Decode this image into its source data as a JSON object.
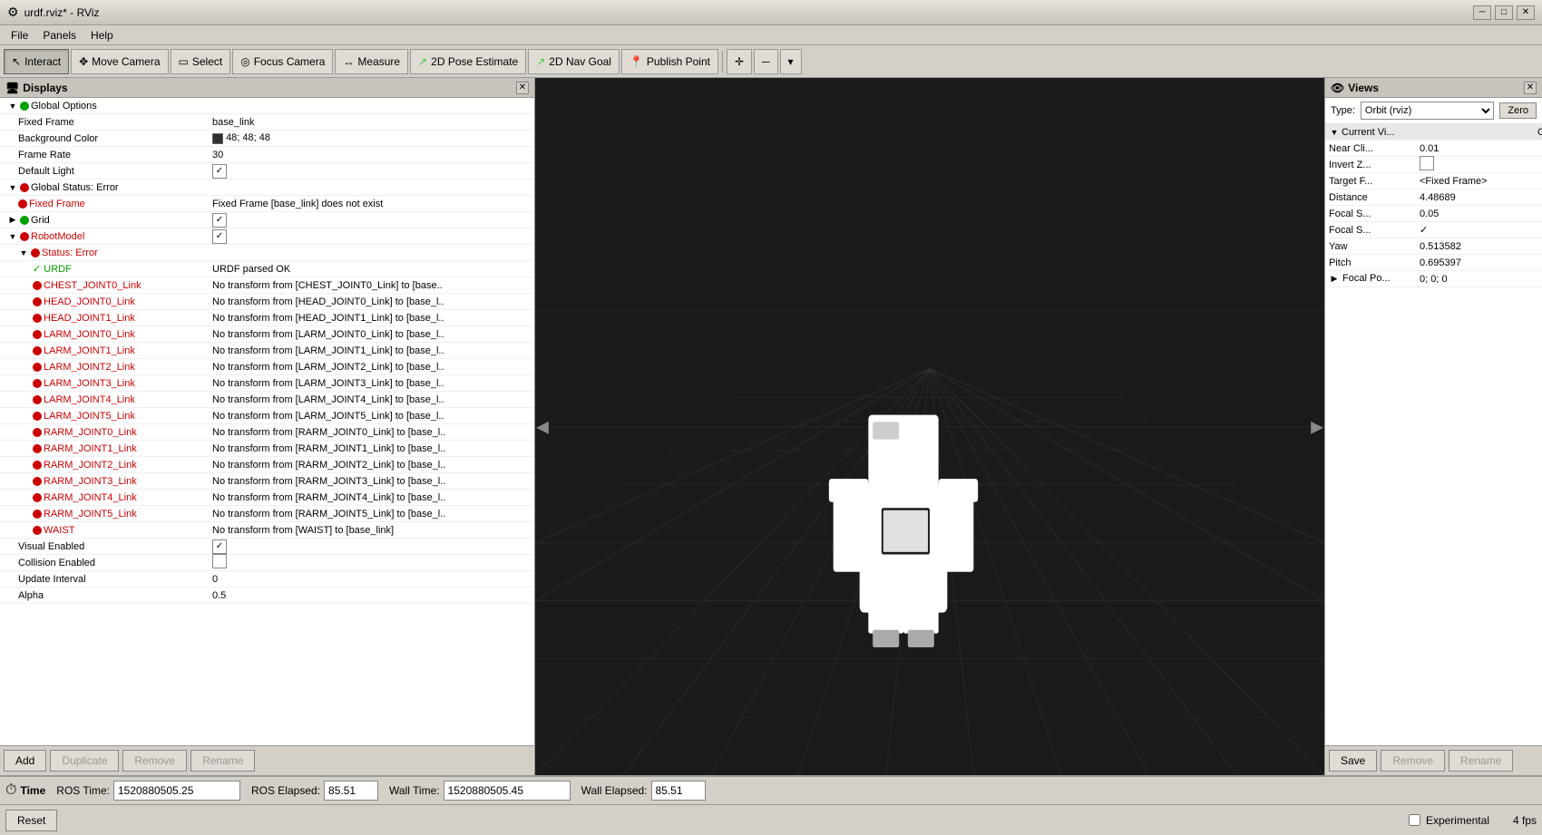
{
  "window": {
    "title": "urdf.rviz* - RViz",
    "icon": "rviz-icon"
  },
  "menu": {
    "items": [
      "File",
      "Panels",
      "Help"
    ]
  },
  "toolbar": {
    "buttons": [
      {
        "id": "interact",
        "label": "Interact",
        "icon": "cursor-icon",
        "active": true
      },
      {
        "id": "move-camera",
        "label": "Move Camera",
        "icon": "move-icon",
        "active": false
      },
      {
        "id": "select",
        "label": "Select",
        "icon": "select-icon",
        "active": false
      },
      {
        "id": "focus-camera",
        "label": "Focus Camera",
        "icon": "focus-icon",
        "active": false
      },
      {
        "id": "measure",
        "label": "Measure",
        "icon": "measure-icon",
        "active": false
      },
      {
        "id": "pose-estimate",
        "label": "2D Pose Estimate",
        "icon": "pose-icon",
        "active": false
      },
      {
        "id": "nav-goal",
        "label": "2D Nav Goal",
        "icon": "nav-icon",
        "active": false
      },
      {
        "id": "publish-point",
        "label": "Publish Point",
        "icon": "publish-icon",
        "active": false
      }
    ]
  },
  "displays": {
    "panel_title": "Displays",
    "items": [
      {
        "id": "global-options",
        "level": 1,
        "expanded": true,
        "label": "Global Options",
        "status": "green",
        "value": "",
        "has_expand": true
      },
      {
        "id": "fixed-frame",
        "level": 2,
        "label": "Fixed Frame",
        "value": "base_link",
        "status": null
      },
      {
        "id": "background-color",
        "level": 2,
        "label": "Background Color",
        "value": "48; 48; 48",
        "status": null,
        "has_color": true
      },
      {
        "id": "frame-rate",
        "level": 2,
        "label": "Frame Rate",
        "value": "30",
        "status": null
      },
      {
        "id": "default-light",
        "level": 2,
        "label": "Default Light",
        "value": "checked",
        "status": null
      },
      {
        "id": "global-status",
        "level": 1,
        "expanded": true,
        "label": "Global Status: Error",
        "status": "red",
        "value": "",
        "has_expand": true
      },
      {
        "id": "fixed-frame-error",
        "level": 2,
        "label": "Fixed Frame",
        "value": "Fixed Frame [base_link] does not exist",
        "status": "red"
      },
      {
        "id": "grid",
        "level": 1,
        "expanded": false,
        "label": "Grid",
        "status": "green",
        "value": "",
        "has_expand": true,
        "has_checkbox": true,
        "checked": true
      },
      {
        "id": "robot-model",
        "level": 1,
        "expanded": true,
        "label": "RobotModel",
        "status": "red",
        "value": "",
        "has_expand": true,
        "has_checkbox": true,
        "checked": true
      },
      {
        "id": "status-error",
        "level": 2,
        "expanded": true,
        "label": "Status: Error",
        "status": "red",
        "has_expand": true
      },
      {
        "id": "urdf",
        "level": 3,
        "label": "URDF",
        "value": "URDF parsed OK",
        "status": "ok_check"
      },
      {
        "id": "chest-joint0",
        "level": 3,
        "label": "CHEST_JOINT0_Link",
        "value": "No transform from [CHEST_JOINT0_Link] to [base..",
        "status": "red"
      },
      {
        "id": "head-joint0",
        "level": 3,
        "label": "HEAD_JOINT0_Link",
        "value": "No transform from [HEAD_JOINT0_Link] to [base_l..",
        "status": "red"
      },
      {
        "id": "head-joint1",
        "level": 3,
        "label": "HEAD_JOINT1_Link",
        "value": "No transform from [HEAD_JOINT1_Link] to [base_l..",
        "status": "red"
      },
      {
        "id": "larm-joint0",
        "level": 3,
        "label": "LARM_JOINT0_Link",
        "value": "No transform from [LARM_JOINT0_Link] to [base_l..",
        "status": "red"
      },
      {
        "id": "larm-joint1",
        "level": 3,
        "label": "LARM_JOINT1_Link",
        "value": "No transform from [LARM_JOINT1_Link] to [base_l..",
        "status": "red"
      },
      {
        "id": "larm-joint2",
        "level": 3,
        "label": "LARM_JOINT2_Link",
        "value": "No transform from [LARM_JOINT2_Link] to [base_l..",
        "status": "red"
      },
      {
        "id": "larm-joint3",
        "level": 3,
        "label": "LARM_JOINT3_Link",
        "value": "No transform from [LARM_JOINT3_Link] to [base_l..",
        "status": "red"
      },
      {
        "id": "larm-joint4",
        "level": 3,
        "label": "LARM_JOINT4_Link",
        "value": "No transform from [LARM_JOINT4_Link] to [base_l..",
        "status": "red"
      },
      {
        "id": "larm-joint5",
        "level": 3,
        "label": "LARM_JOINT5_Link",
        "value": "No transform from [LARM_JOINT5_Link] to [base_l..",
        "status": "red"
      },
      {
        "id": "rarm-joint0",
        "level": 3,
        "label": "RARM_JOINT0_Link",
        "value": "No transform from [RARM_JOINT0_Link] to [base_l..",
        "status": "red"
      },
      {
        "id": "rarm-joint1",
        "level": 3,
        "label": "RARM_JOINT1_Link",
        "value": "No transform from [RARM_JOINT1_Link] to [base_l..",
        "status": "red"
      },
      {
        "id": "rarm-joint2",
        "level": 3,
        "label": "RARM_JOINT2_Link",
        "value": "No transform from [RARM_JOINT2_Link] to [base_l..",
        "status": "red"
      },
      {
        "id": "rarm-joint3",
        "level": 3,
        "label": "RARM_JOINT3_Link",
        "value": "No transform from [RARM_JOINT3_Link] to [base_l..",
        "status": "red"
      },
      {
        "id": "rarm-joint4",
        "level": 3,
        "label": "RARM_JOINT4_Link",
        "value": "No transform from [RARM_JOINT4_Link] to [base_l..",
        "status": "red"
      },
      {
        "id": "rarm-joint5",
        "level": 3,
        "label": "RARM_JOINT5_Link",
        "value": "No transform from [RARM_JOINT5_Link] to [base_l..",
        "status": "red"
      },
      {
        "id": "waist",
        "level": 3,
        "label": "WAIST",
        "value": "No transform from [WAIST] to [base_link]",
        "status": "red"
      },
      {
        "id": "visual-enabled",
        "level": 2,
        "label": "Visual Enabled",
        "value": "checked",
        "status": null
      },
      {
        "id": "collision-enabled",
        "level": 2,
        "label": "Collision Enabled",
        "value": "unchecked",
        "status": null
      },
      {
        "id": "update-interval",
        "level": 2,
        "label": "Update Interval",
        "value": "0",
        "status": null
      },
      {
        "id": "alpha",
        "level": 2,
        "label": "Alpha",
        "value": "0.5",
        "status": null
      }
    ],
    "footer_buttons": [
      "Add",
      "Duplicate",
      "Remove",
      "Rename"
    ]
  },
  "views": {
    "panel_title": "Views",
    "type_label": "Type:",
    "type_value": "Orbit (rviz)",
    "zero_btn": "Zero",
    "current_view_label": "Current Vi...",
    "current_view_type": "Orbit (rviz)",
    "properties": [
      {
        "label": "Near Cli...",
        "value": "0.01"
      },
      {
        "label": "Invert Z...",
        "value": "",
        "is_checkbox": true,
        "checked": false
      },
      {
        "label": "Target F...",
        "value": "<Fixed Frame>"
      },
      {
        "label": "Distance",
        "value": "4.48689"
      },
      {
        "label": "Focal S...",
        "value": "0.05"
      },
      {
        "label": "Focal S...",
        "value": "✓",
        "is_check": true
      },
      {
        "label": "Yaw",
        "value": "0.513582"
      },
      {
        "label": "Pitch",
        "value": "0.695397"
      },
      {
        "label": "Focal Po...",
        "value": "0; 0; 0",
        "has_expand": true
      }
    ],
    "footer_buttons": [
      "Save",
      "Remove",
      "Rename"
    ]
  },
  "time": {
    "section_title": "Time",
    "ros_time_label": "ROS Time:",
    "ros_time_value": "1520880505.25",
    "ros_elapsed_label": "ROS Elapsed:",
    "ros_elapsed_value": "85.51",
    "wall_time_label": "Wall Time:",
    "wall_time_value": "1520880505.45",
    "wall_elapsed_label": "Wall Elapsed:",
    "wall_elapsed_value": "85.51"
  },
  "bottom": {
    "reset_btn": "Reset",
    "experimental_label": "Experimental",
    "fps": "4 fps"
  },
  "colors": {
    "background_swatch": "#303030",
    "status_red": "#cc0000",
    "status_green": "#00aa00",
    "viewport_bg": "#1a1a1a",
    "grid_line": "#404040"
  }
}
